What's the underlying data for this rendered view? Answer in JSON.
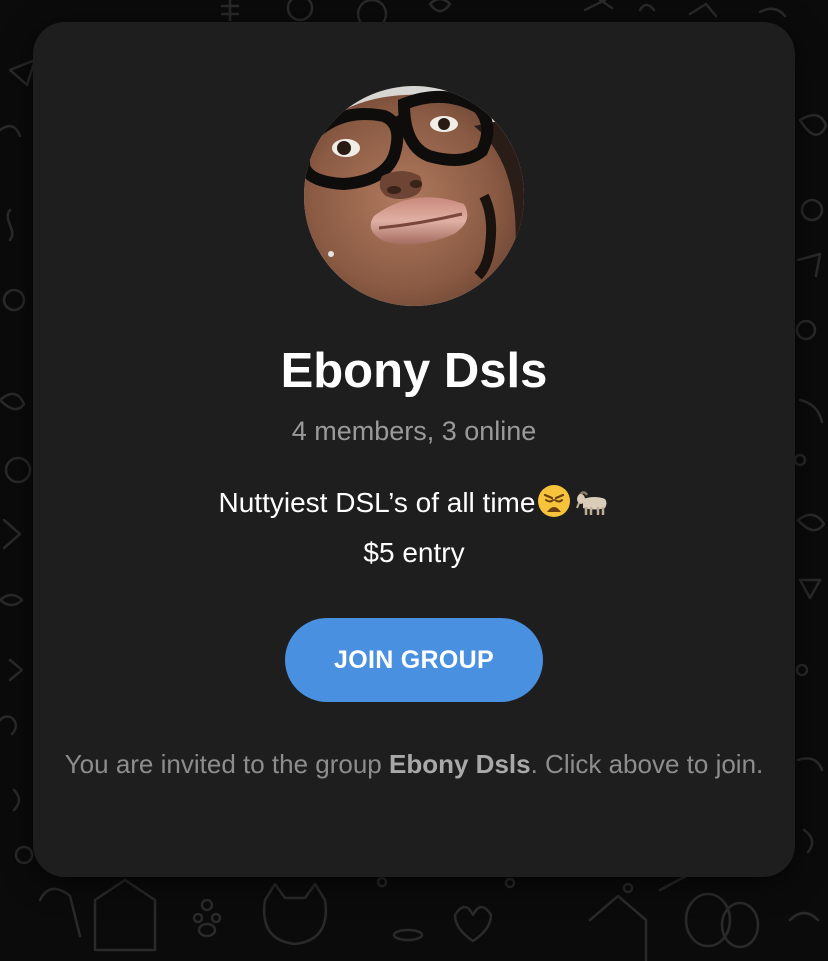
{
  "group": {
    "name": "Ebony Dsls",
    "members_status": "4 members, 3 online",
    "description_line1": "Nuttyiest DSL’s of all time",
    "description_line1_emojis": [
      "weary-face-emoji",
      "goat-emoji"
    ],
    "description_line2": "$5 entry"
  },
  "join_button": {
    "label": "JOIN GROUP"
  },
  "invite": {
    "prefix": "You are invited to the group ",
    "group_name": "Ebony Dsls",
    "suffix": ". Click above to join."
  },
  "colors": {
    "card_background": "#1e1e1e",
    "page_background": "#0b0b0b",
    "button": "#4a90e0",
    "muted_text": "#9a9a9a"
  }
}
